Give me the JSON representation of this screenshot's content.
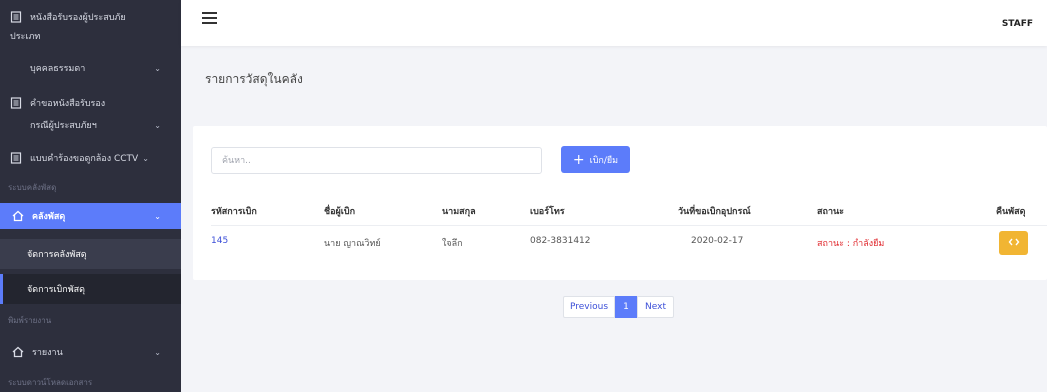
{
  "sidebar": {
    "items": [
      {
        "label": "หนังสือรับรองผู้ประสบภัย",
        "icon": "document-icon"
      },
      {
        "label": "ประเภท"
      },
      {
        "label": "บุคคลธรรมดา"
      },
      {
        "label": "คำขอหนังสือรับรอง",
        "icon": "document-icon"
      },
      {
        "label": "กรณีผู้ประสบภัยฯ"
      },
      {
        "label": "แบบคำร้องขอดูกล้อง CCTV",
        "icon": "document-icon"
      }
    ],
    "section_inventory": "ระบบคลังพัสดุ",
    "inventory_menu": {
      "label": "คลังพัสดุ",
      "icon": "home-icon"
    },
    "inventory_sub": [
      "จัดการคลังพัสดุ",
      "จัดการเบิกพัสดุ"
    ],
    "section_print": "พิมพ์รายงาน",
    "report_menu": {
      "label": "รายงาน",
      "icon": "home-icon"
    },
    "section_download": "ระบบดาวน์โหลดเอกสาร"
  },
  "topbar": {
    "user": "STAFF"
  },
  "page": {
    "title": "รายการวัสดุในคลัง"
  },
  "search": {
    "placeholder": "ค้นหา.."
  },
  "add_button": {
    "label": "เบิก/ยืม"
  },
  "table": {
    "headers": [
      "รหัสการเบิก",
      "ชื่อผู้เบิก",
      "นามสกุล",
      "เบอร์โทร",
      "วันที่ขอเบิกอุปกรณ์",
      "สถานะ",
      "คืนพัสดุ"
    ],
    "rows": [
      {
        "id": "145",
        "name": "นาย ญาณวิทย์",
        "surname": "ใจลึก",
        "phone": "082-3831412",
        "date": "2020-02-17",
        "status": "สถานะ : กำลังยืม"
      }
    ]
  },
  "pagination": {
    "prev": "Previous",
    "current": "1",
    "next": "Next"
  },
  "colors": {
    "sidebar": "#2d2f3d",
    "accent": "#5c7cfa",
    "return": "#f1b533",
    "status": "#e0262b"
  }
}
